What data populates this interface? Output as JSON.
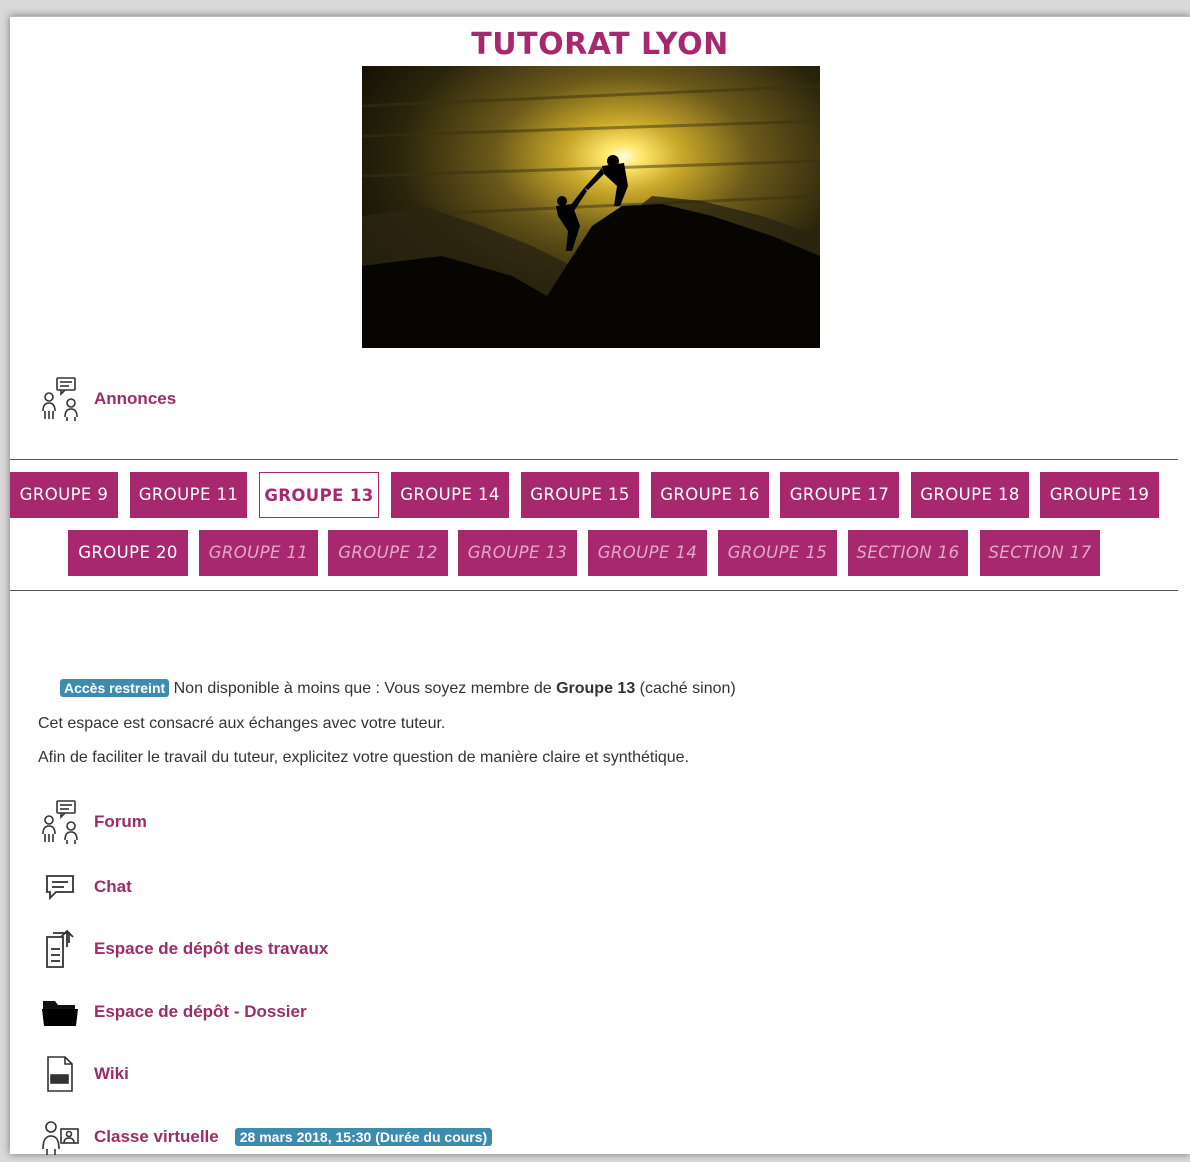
{
  "course_title": "TUTORAT LYON",
  "announcements": {
    "label": "Annonces",
    "icon": "people-discussion-icon"
  },
  "tabs_row1": [
    {
      "label": "GROUPE 9",
      "state": "normal"
    },
    {
      "label": "GROUPE 11",
      "state": "normal"
    },
    {
      "label": "GROUPE 13",
      "state": "active"
    },
    {
      "label": "GROUPE 14",
      "state": "normal"
    },
    {
      "label": "GROUPE 15",
      "state": "normal"
    },
    {
      "label": "GROUPE 16",
      "state": "normal"
    },
    {
      "label": "GROUPE 17",
      "state": "normal"
    },
    {
      "label": "GROUPE 18",
      "state": "normal"
    },
    {
      "label": "GROUPE 19",
      "state": "normal"
    }
  ],
  "tabs_row2": [
    {
      "label": "GROUPE 20",
      "state": "normal"
    },
    {
      "label": "GROUPE 11",
      "state": "hidden"
    },
    {
      "label": "GROUPE 12",
      "state": "hidden"
    },
    {
      "label": "GROUPE 13",
      "state": "hidden"
    },
    {
      "label": "GROUPE 14",
      "state": "hidden"
    },
    {
      "label": "GROUPE 15",
      "state": "hidden"
    },
    {
      "label": "SECTION 16",
      "state": "hidden"
    },
    {
      "label": "SECTION 17",
      "state": "hidden"
    }
  ],
  "restriction": {
    "badge": "Accès restreint",
    "text_before": "Non disponible à moins que : Vous soyez membre de",
    "group": "Groupe 13",
    "text_after": "(caché sinon)"
  },
  "section_description": [
    "Cet espace est consacré aux échanges avec votre tuteur.",
    "Afin de faciliter le travail du tuteur, explicitez votre question de manière claire et synthétique."
  ],
  "activities": [
    {
      "label": "Forum",
      "icon": "forum-icon"
    },
    {
      "label": "Chat",
      "icon": "chat-icon"
    },
    {
      "label": "Espace de dépôt des travaux",
      "icon": "assignment-upload-icon"
    },
    {
      "label": "Espace de dépôt - Dossier",
      "icon": "folder-icon"
    },
    {
      "label": "Wiki",
      "icon": "wiki-icon"
    },
    {
      "label": "Classe virtuelle",
      "icon": "virtual-class-icon",
      "badge": "28 mars 2018, 15:30 (Durée du cours)"
    }
  ],
  "colors": {
    "brand": "#a8286f",
    "link": "#9c2c6a",
    "badge": "#3e8bb0"
  }
}
